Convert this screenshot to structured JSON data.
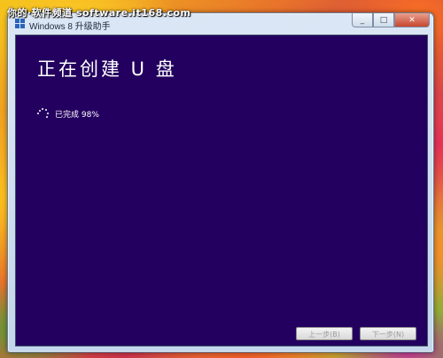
{
  "watermark": "你的·软件频道 software.it168.com",
  "window": {
    "title": "Windows 8 升级助手",
    "icon": "windows-logo-icon",
    "controls": {
      "minimize": "_",
      "maximize": "□",
      "close": "✕"
    }
  },
  "main": {
    "title": "正在创建 U 盘",
    "status": "已完成 98%",
    "progress_percent": 98,
    "spinner_icon": "loading-spinner-icon"
  },
  "buttons": {
    "prev_label": "上一步(B)",
    "next_label": "下一步(N)"
  },
  "colors": {
    "content_background": "#23005f",
    "text": "#ffffff"
  }
}
